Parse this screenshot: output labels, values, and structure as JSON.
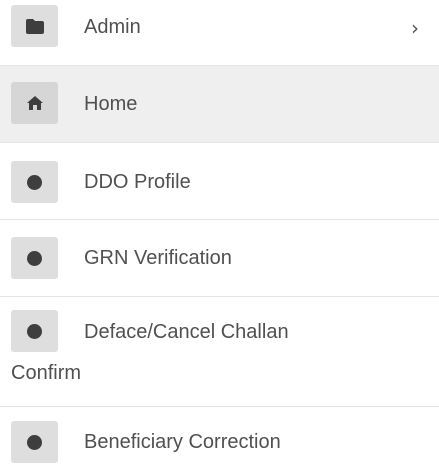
{
  "menu": {
    "items": [
      {
        "label": "Admin",
        "icon": "folder-icon",
        "has_submenu": true,
        "chevron": "›"
      },
      {
        "label": "Home",
        "icon": "home-icon",
        "active": true
      },
      {
        "label": "DDO Profile",
        "icon": "circle-icon"
      },
      {
        "label": "GRN Verification",
        "icon": "circle-icon"
      },
      {
        "label_line1": "Deface/Cancel Challan",
        "label_line2": "Confirm",
        "icon": "circle-icon"
      },
      {
        "label": "Beneficiary Correction",
        "icon": "circle-icon"
      }
    ]
  },
  "colors": {
    "active_background": "#efefef",
    "icon_background": "#dedede",
    "divider": "#e4e4e4",
    "text": "#505050"
  }
}
